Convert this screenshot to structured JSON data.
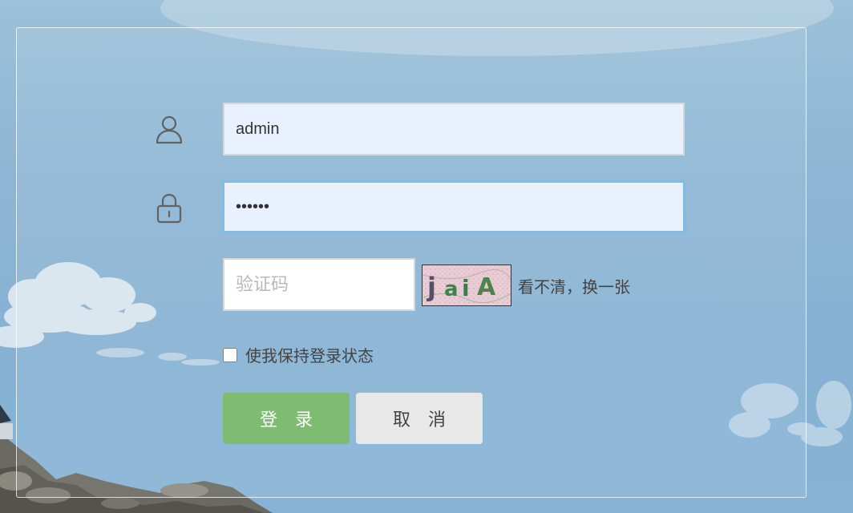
{
  "form": {
    "username": {
      "icon": "user-icon",
      "value": "admin"
    },
    "password": {
      "icon": "lock-icon",
      "value": "123456"
    },
    "captcha": {
      "placeholder": "验证码",
      "value": "",
      "image_text": "jaiA",
      "refresh_label": "看不清，换一张"
    },
    "remember": {
      "label": "使我保持登录状态",
      "checked": false
    },
    "buttons": {
      "login_label": "登　录",
      "cancel_label": "取　消"
    }
  },
  "colors": {
    "login_button": "#74b765",
    "cancel_button": "#e6e6e6",
    "input_background": "#e8f0fe",
    "focus_border": "#73b7e5"
  }
}
